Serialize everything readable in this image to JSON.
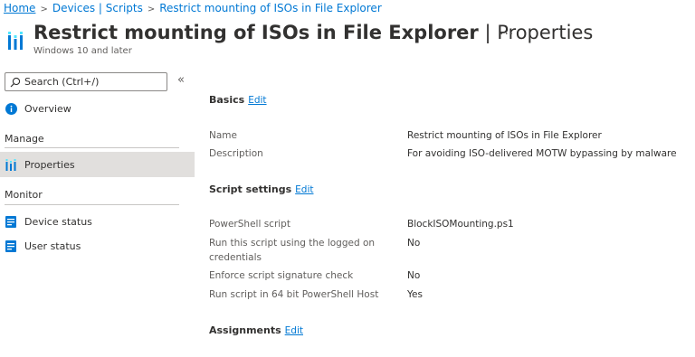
{
  "breadcrumb": {
    "home": "Home",
    "devices": "Devices | Scripts",
    "current": "Restrict mounting of ISOs in File Explorer"
  },
  "header": {
    "title": "Restrict mounting of ISOs in File Explorer",
    "separator": "|",
    "section": "Properties",
    "subtitle": "Windows 10 and later",
    "more": "···"
  },
  "sidebar": {
    "search_placeholder": "Search (Ctrl+/)",
    "collapse": "«",
    "overview": "Overview",
    "manage_heading": "Manage",
    "properties": "Properties",
    "monitor_heading": "Monitor",
    "device_status": "Device status",
    "user_status": "User status"
  },
  "content": {
    "basics": {
      "title": "Basics",
      "edit": "Edit",
      "name_label": "Name",
      "name_value": "Restrict mounting of ISOs in File Explorer",
      "description_label": "Description",
      "description_value": "For avoiding ISO-delivered MOTW bypassing by malware"
    },
    "script_settings": {
      "title": "Script settings",
      "edit": "Edit",
      "powershell_label": "PowerShell script",
      "powershell_value": "BlockISOMounting.ps1",
      "logged_on_label": "Run this script using the logged on credentials",
      "logged_on_value": "No",
      "signature_label": "Enforce script signature check",
      "signature_value": "No",
      "host64_label": "Run script in 64 bit PowerShell Host",
      "host64_value": "Yes"
    },
    "assignments": {
      "title": "Assignments",
      "edit": "Edit"
    }
  },
  "colors": {
    "accent": "#0078d4",
    "selected_bg": "#e1dfdd",
    "text": "#323130",
    "muted": "#605e5c"
  }
}
